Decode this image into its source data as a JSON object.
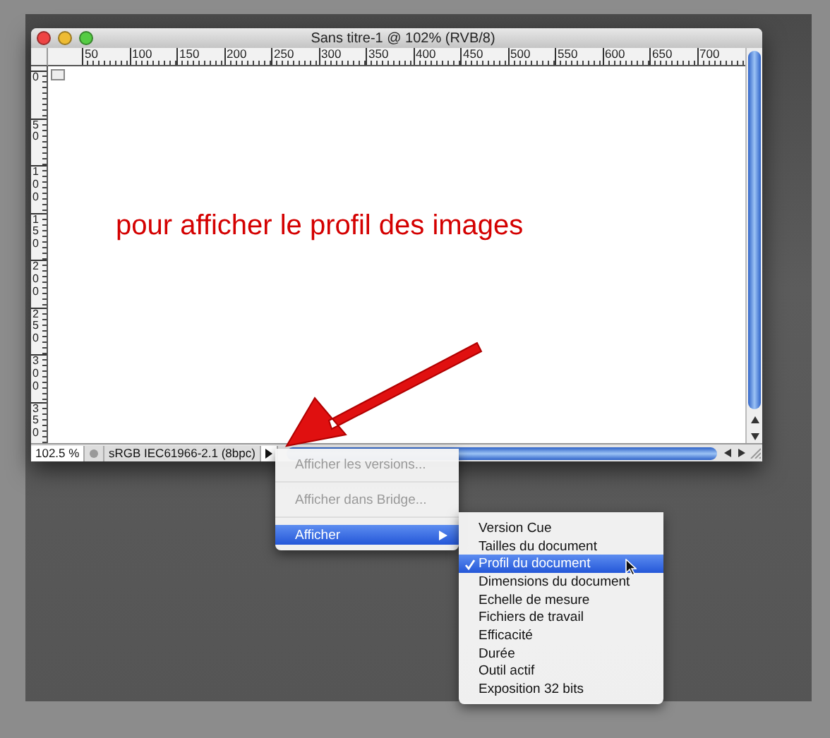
{
  "window": {
    "title": "Sans titre-1 @ 102% (RVB/8)"
  },
  "rulers": {
    "horizontal": [
      "50",
      "100",
      "150",
      "200",
      "250",
      "300",
      "350",
      "400",
      "450",
      "500",
      "550",
      "600",
      "650",
      "700"
    ],
    "vertical": [
      "0",
      "50",
      "100",
      "150",
      "200",
      "250",
      "300",
      "350"
    ]
  },
  "canvas": {
    "annotation": "pour afficher le profil des images"
  },
  "status_bar": {
    "zoom": "102.5 %",
    "info": "sRGB IEC61966-2.1 (8bpc)"
  },
  "menu": [
    {
      "label": "Afficher les versions...",
      "disabled": true,
      "selected": false,
      "submenu": false
    },
    {
      "label": "Afficher dans Bridge...",
      "disabled": true,
      "selected": false,
      "submenu": false
    },
    {
      "label": "Afficher",
      "disabled": false,
      "selected": true,
      "submenu": true
    }
  ],
  "submenu": [
    {
      "label": "Version Cue",
      "checked": false,
      "selected": false
    },
    {
      "label": "Tailles du document",
      "checked": false,
      "selected": false
    },
    {
      "label": "Profil du document",
      "checked": true,
      "selected": true
    },
    {
      "label": "Dimensions du document",
      "checked": false,
      "selected": false
    },
    {
      "label": "Echelle de mesure",
      "checked": false,
      "selected": false
    },
    {
      "label": "Fichiers de travail",
      "checked": false,
      "selected": false
    },
    {
      "label": "Efficacité",
      "checked": false,
      "selected": false
    },
    {
      "label": "Durée",
      "checked": false,
      "selected": false
    },
    {
      "label": "Outil actif",
      "checked": false,
      "selected": false
    },
    {
      "label": "Exposition 32 bits",
      "checked": false,
      "selected": false
    }
  ]
}
